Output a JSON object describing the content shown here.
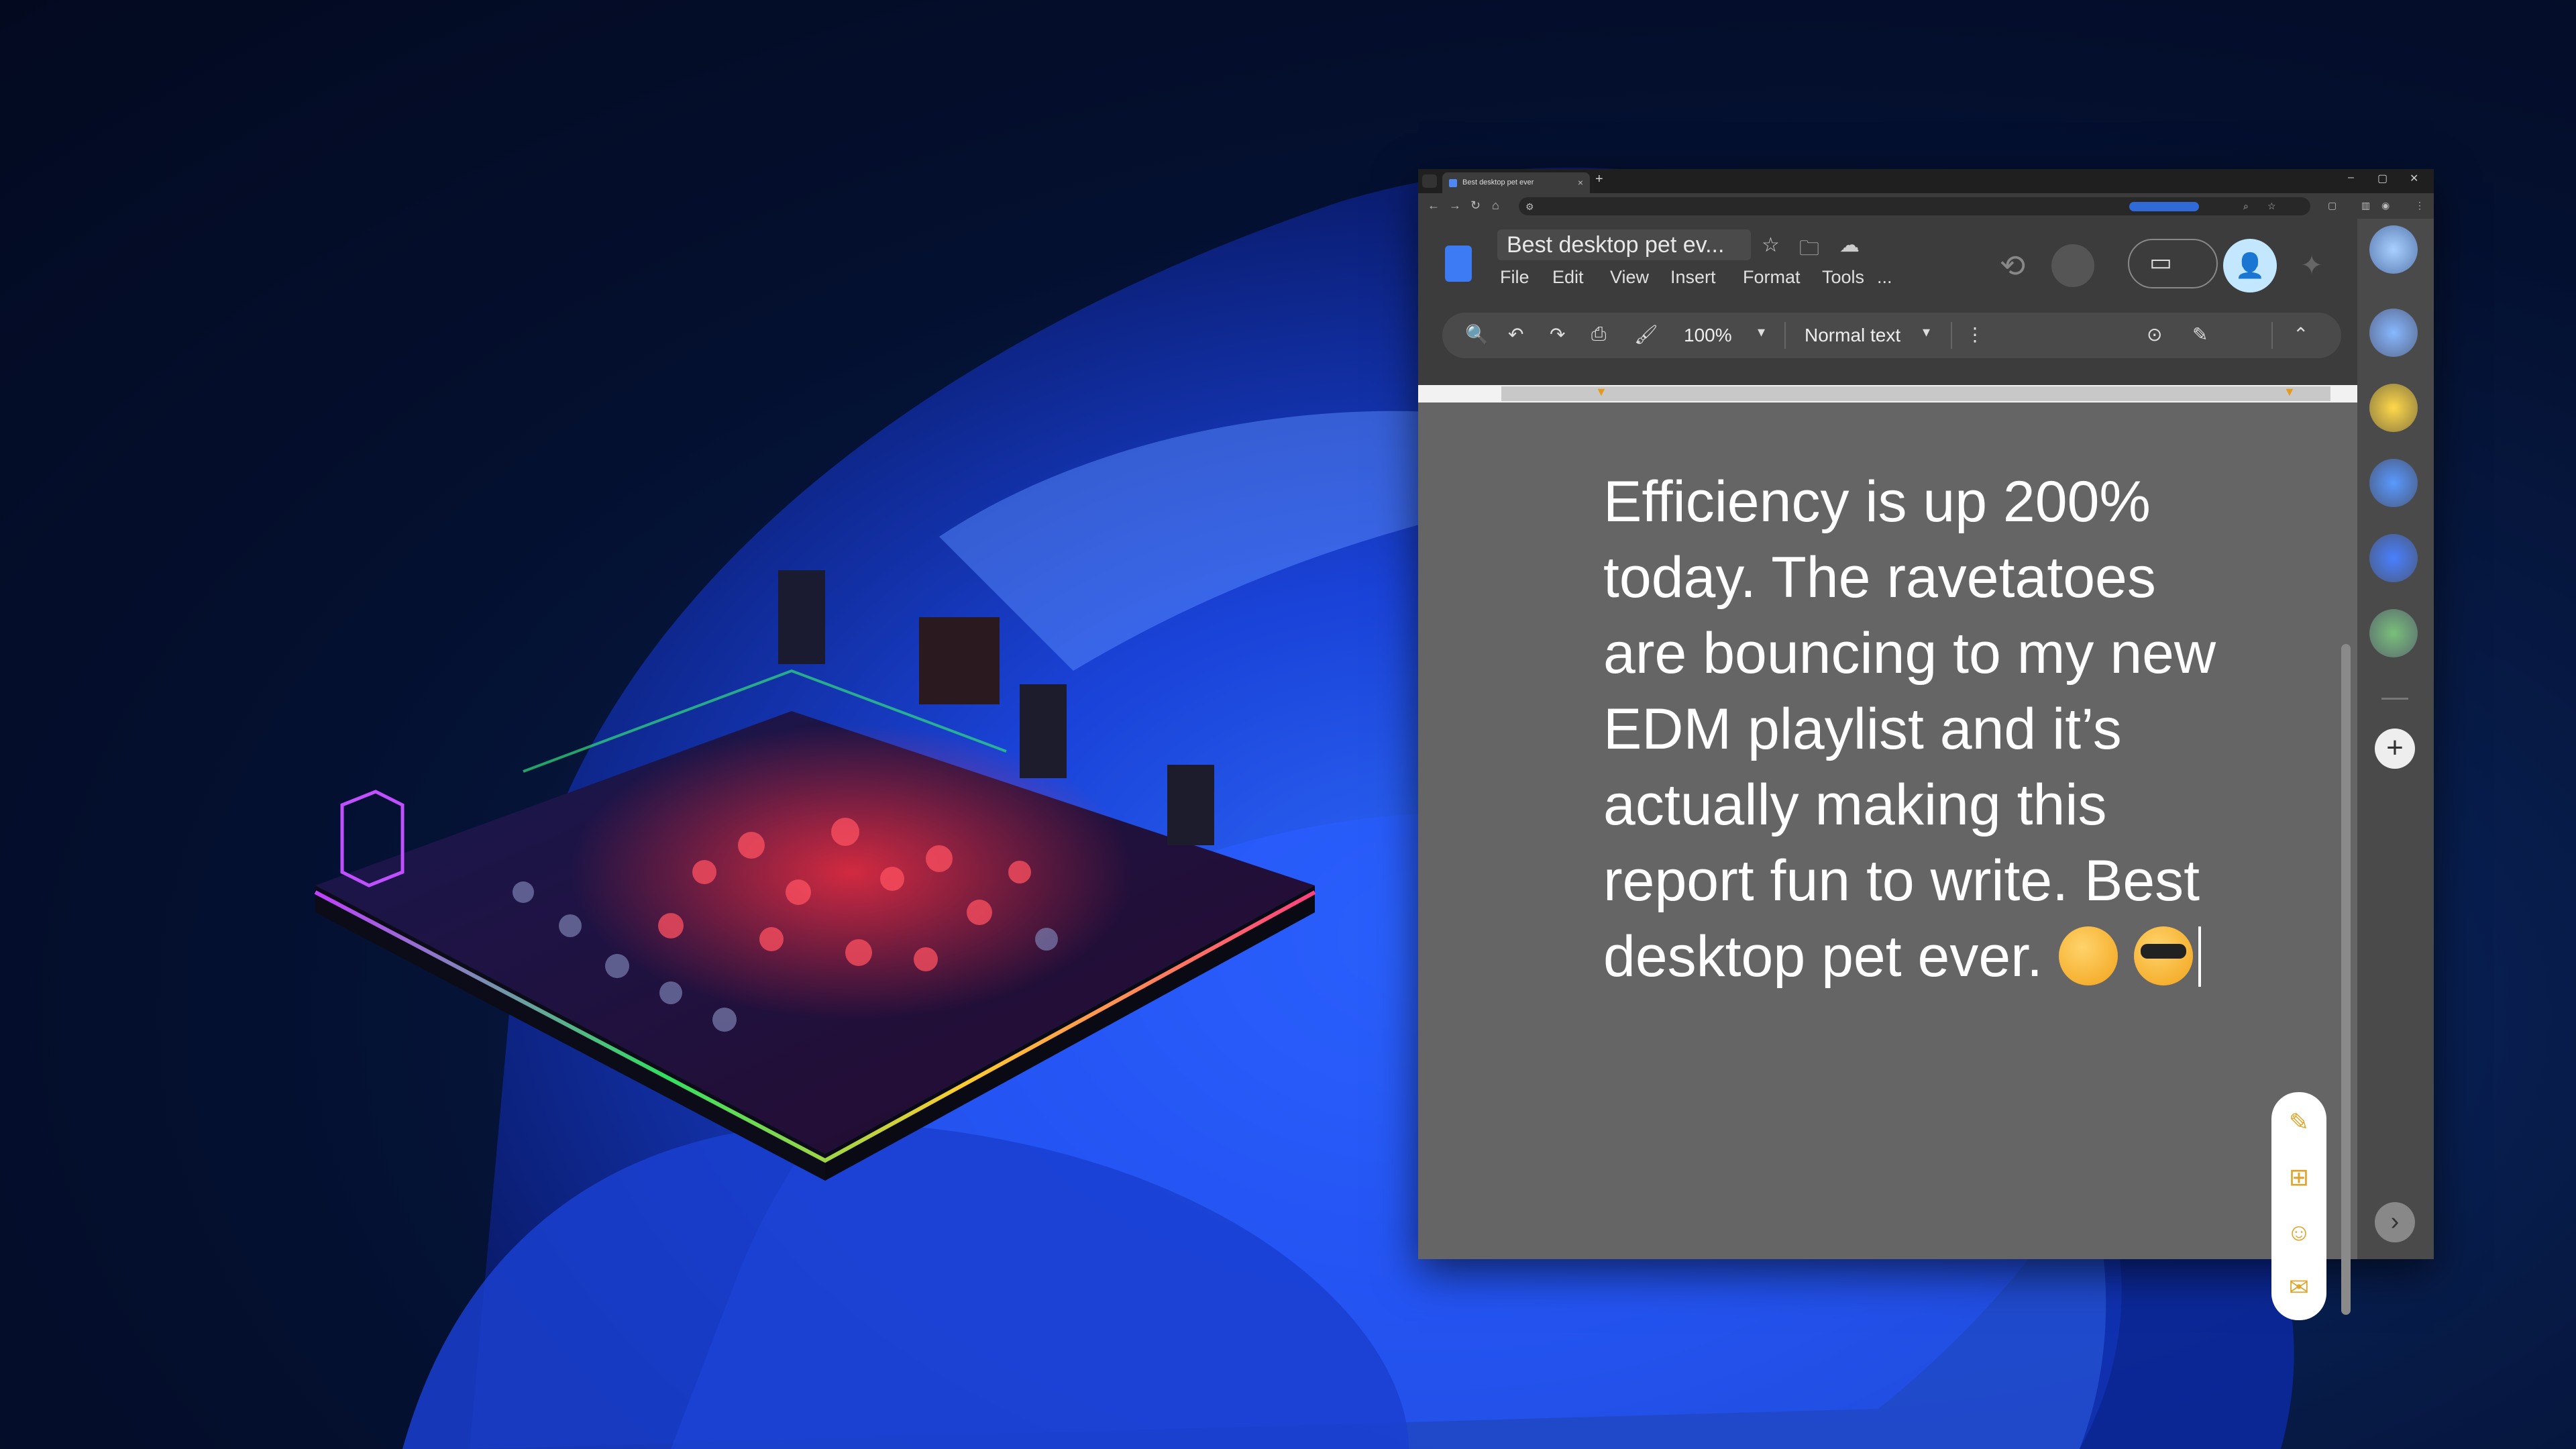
{
  "browser": {
    "tab_title": "Best desktop pet ever",
    "tab_close": "×",
    "new_tab": "+",
    "window_controls": [
      "–",
      "▢",
      "✕"
    ]
  },
  "docs": {
    "title": "Best desktop pet ev...",
    "menu": [
      "File",
      "Edit",
      "View",
      "Insert",
      "Format",
      "Tools",
      "..."
    ],
    "zoom": "100%",
    "style": "Normal text",
    "body_lines": [
      "Efficiency is up 200%",
      "today. The ravetatoes",
      "are bouncing to my new",
      "EDM playlist and it’s",
      "actually making this",
      "report fun to write. Best",
      "desktop pet ever."
    ],
    "icons": {
      "star": "star-icon",
      "folder": "folder-icon",
      "cloud": "cloud-icon",
      "history": "history-icon",
      "meet": "video-icon",
      "share": "add-person-icon"
    }
  },
  "toolbar": {
    "search": "🔍",
    "undo": "↶",
    "redo": "↷",
    "print": "⎙",
    "paint": "🖌",
    "more": "⋮",
    "edit_mode": "✎",
    "collapse": "⌃",
    "caret": "▾"
  },
  "side_tools": [
    "✎",
    "⊞",
    "☺",
    "✉"
  ],
  "rail": {
    "add": "+",
    "next": "›"
  },
  "colors": {
    "accent": "#3d7bf5",
    "share_bg": "#c2e7ff",
    "doc_bg": "#656565",
    "side_tool": "#e0a42a"
  }
}
